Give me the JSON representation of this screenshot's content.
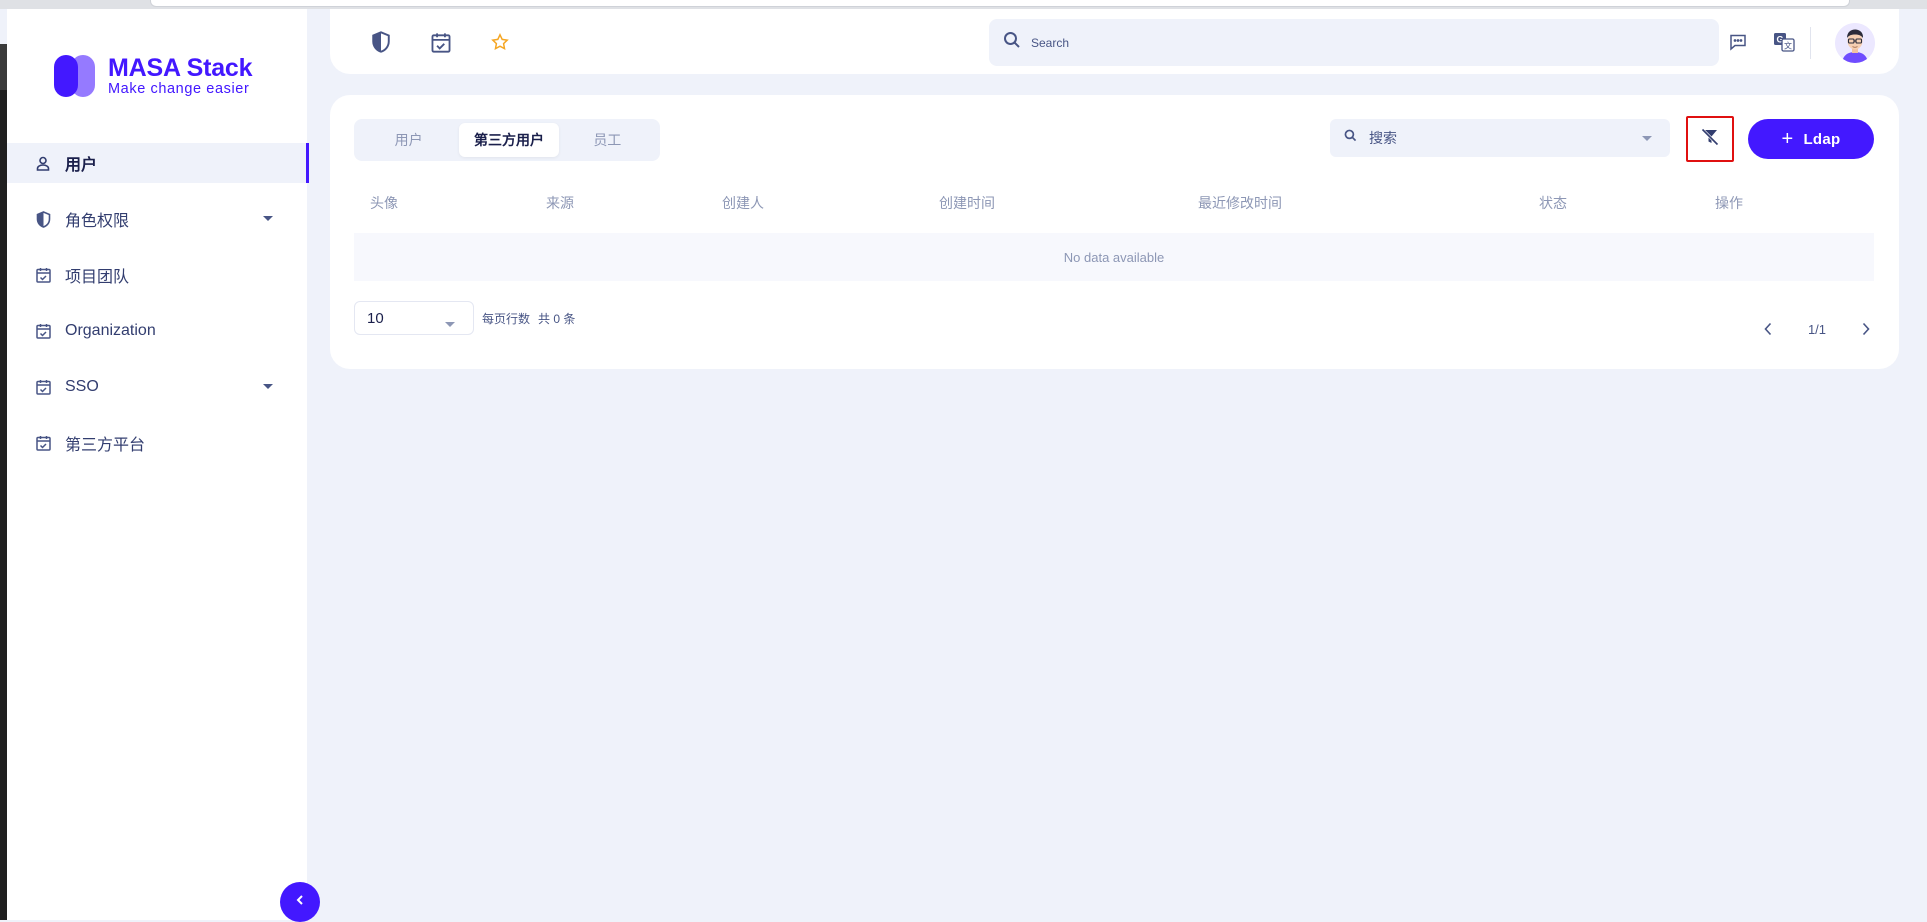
{
  "brand": {
    "title": "MASA Stack",
    "subtitle": "Make change easier"
  },
  "sidebar": {
    "items": [
      {
        "label": "用户",
        "icon": "user-icon",
        "active": true
      },
      {
        "label": "角色权限",
        "icon": "shield-icon",
        "expandable": true
      },
      {
        "label": "项目团队",
        "icon": "calendar-check-icon"
      },
      {
        "label": "Organization",
        "icon": "calendar-check-icon"
      },
      {
        "label": "SSO",
        "icon": "calendar-check-icon",
        "expandable": true
      },
      {
        "label": "第三方平台",
        "icon": "calendar-check-icon"
      }
    ]
  },
  "header": {
    "icons": [
      "shield-icon",
      "calendar-check-icon",
      "star-icon"
    ],
    "search": {
      "placeholder": "Search",
      "value": ""
    },
    "right_icons": [
      "message-icon",
      "translate-icon"
    ]
  },
  "tabs": [
    {
      "label": "用户"
    },
    {
      "label": "第三方用户",
      "active": true
    },
    {
      "label": "员工"
    }
  ],
  "filter": {
    "search_placeholder": "搜索"
  },
  "actions": {
    "add_label": "Ldap"
  },
  "table": {
    "columns": [
      "头像",
      "来源",
      "创建人",
      "创建时间",
      "最近修改时间",
      "状态",
      "操作"
    ],
    "empty_text": "No data available"
  },
  "pagination": {
    "page_size": "10",
    "per_page_label": "每页行数",
    "total_label": "共 0 条",
    "page_indicator": "1/1"
  },
  "colors": {
    "accent": "#4318ff",
    "highlight_border": "#e01010",
    "background": "#eff2fa"
  }
}
